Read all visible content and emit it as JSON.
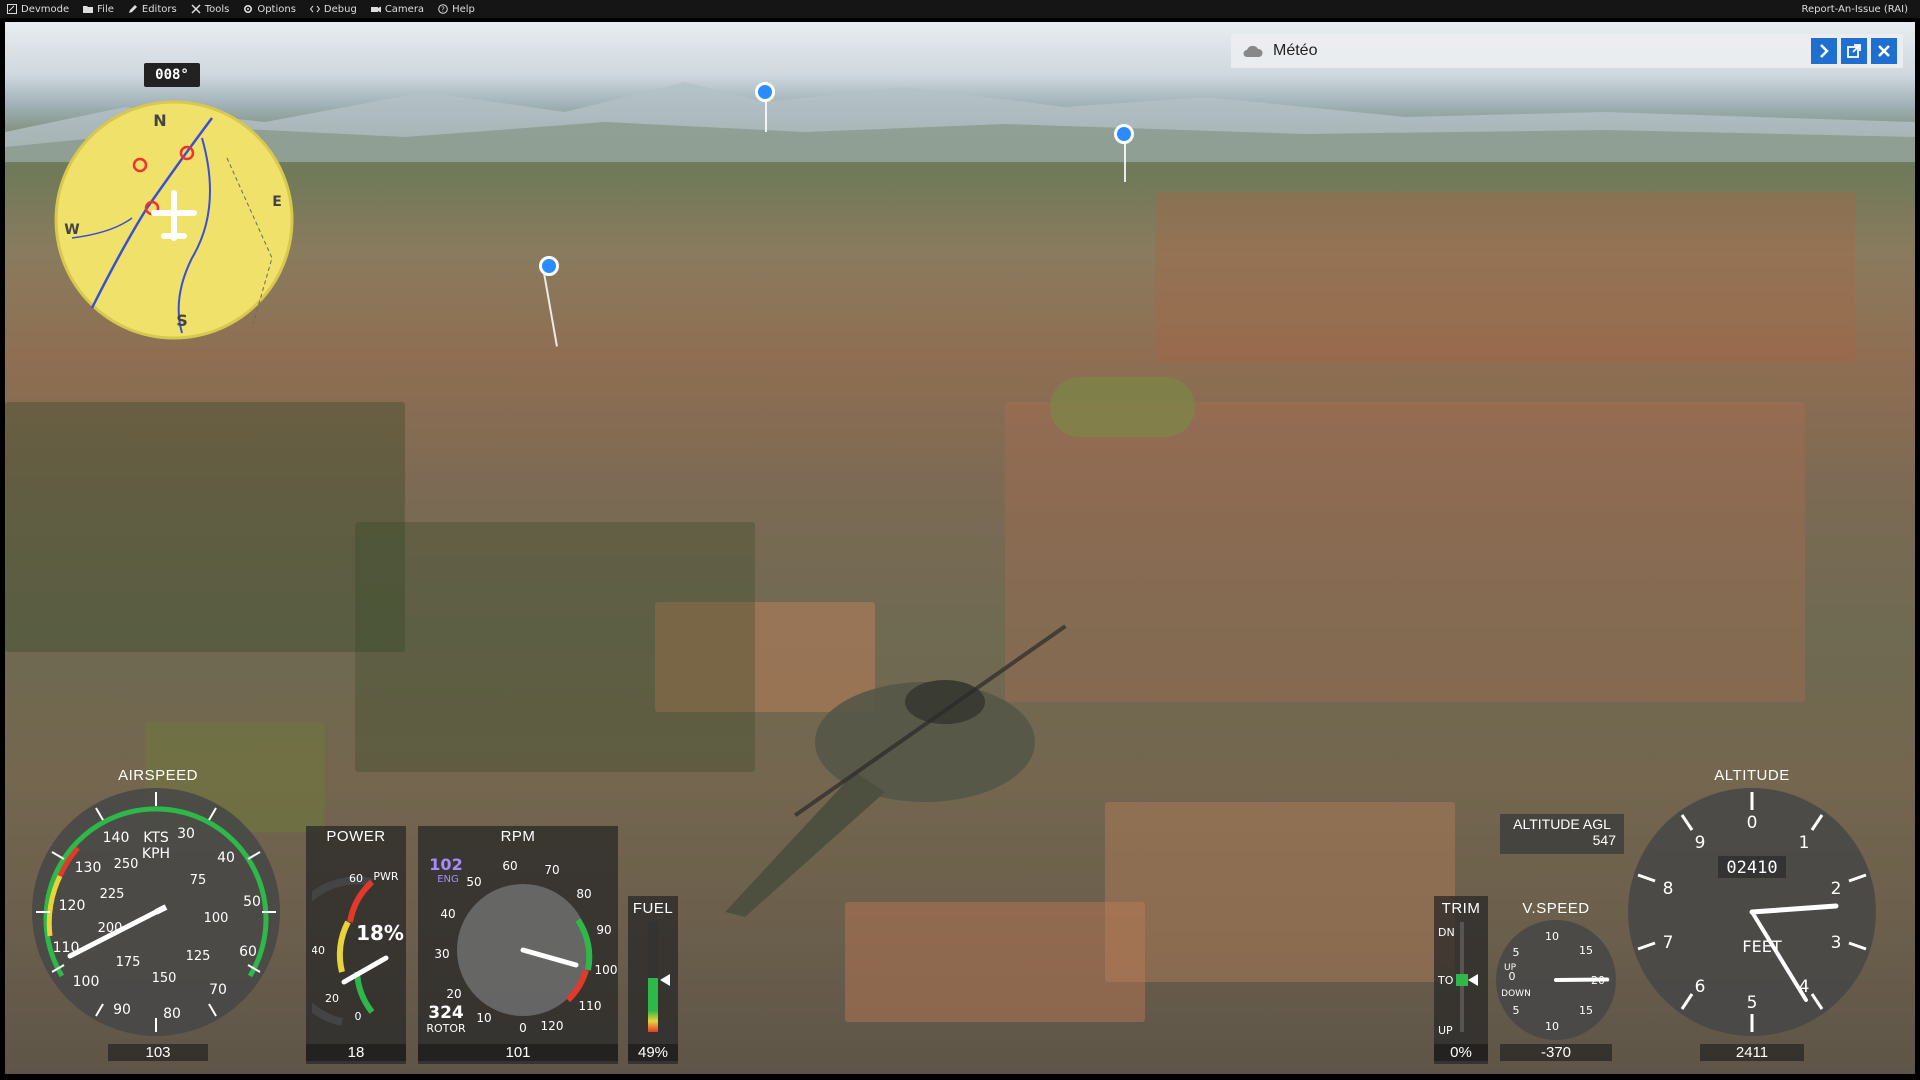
{
  "menu": {
    "items": [
      {
        "label": "Devmode",
        "icon": "devmode-icon"
      },
      {
        "label": "File",
        "icon": "folder-icon"
      },
      {
        "label": "Editors",
        "icon": "pencil-icon"
      },
      {
        "label": "Tools",
        "icon": "tools-icon"
      },
      {
        "label": "Options",
        "icon": "gear-icon"
      },
      {
        "label": "Debug",
        "icon": "code-icon"
      },
      {
        "label": "Camera",
        "icon": "camera-icon"
      },
      {
        "label": "Help",
        "icon": "help-icon"
      }
    ],
    "report": "Report-An-Issue (RAI)"
  },
  "compass": {
    "heading": "008°",
    "north": "N",
    "south": "S",
    "east": "E",
    "west": "W"
  },
  "meteo": {
    "title": "Météo"
  },
  "airspeed": {
    "label": "AIRSPEED",
    "unit_kts": "KTS",
    "unit_kph": "KPH",
    "value": "103",
    "kts_ticks": [
      "30",
      "40",
      "50",
      "60",
      "70",
      "80",
      "90",
      "100",
      "110",
      "120",
      "130",
      "140"
    ],
    "kph_ticks": [
      "75",
      "100",
      "125",
      "150",
      "175",
      "200",
      "225",
      "250"
    ]
  },
  "power": {
    "label": "POWER",
    "pwr": "PWR",
    "percent": "18%",
    "value": "18",
    "ticks": [
      "0",
      "20",
      "40",
      "60"
    ]
  },
  "rpm": {
    "label": "RPM",
    "eng": "102",
    "eng_label": "ENG",
    "rotor": "324",
    "rotor_label": "ROTOR",
    "value": "101",
    "ticks": [
      "0",
      "10",
      "20",
      "30",
      "40",
      "50",
      "60",
      "70",
      "80",
      "90",
      "100",
      "110",
      "120"
    ]
  },
  "fuel": {
    "label": "FUEL",
    "value": "49%",
    "level": 0.49
  },
  "trim": {
    "label": "TRIM",
    "dn": "DN",
    "to": "TO",
    "up": "UP",
    "value": "0%"
  },
  "vspeed": {
    "label": "V.SPEED",
    "value": "-370",
    "up": "UP",
    "down": "DOWN",
    "ticks": [
      "0",
      "5",
      "10",
      "15",
      "20",
      "15",
      "10",
      "5"
    ]
  },
  "altitude_agl": {
    "label": "ALTITUDE AGL",
    "value": "547"
  },
  "altitude": {
    "label": "ALTITUDE",
    "unit": "FEET",
    "value": "2411",
    "drum": "02410",
    "ticks": [
      "0",
      "1",
      "2",
      "3",
      "4",
      "5",
      "6",
      "7",
      "8",
      "9"
    ]
  },
  "colors": {
    "accent": "#1f6fd0",
    "green_arc": "#2fb84a",
    "yellow_arc": "#e9d23a",
    "red_arc": "#e23a2a",
    "compass_bg": "#efe16a"
  }
}
